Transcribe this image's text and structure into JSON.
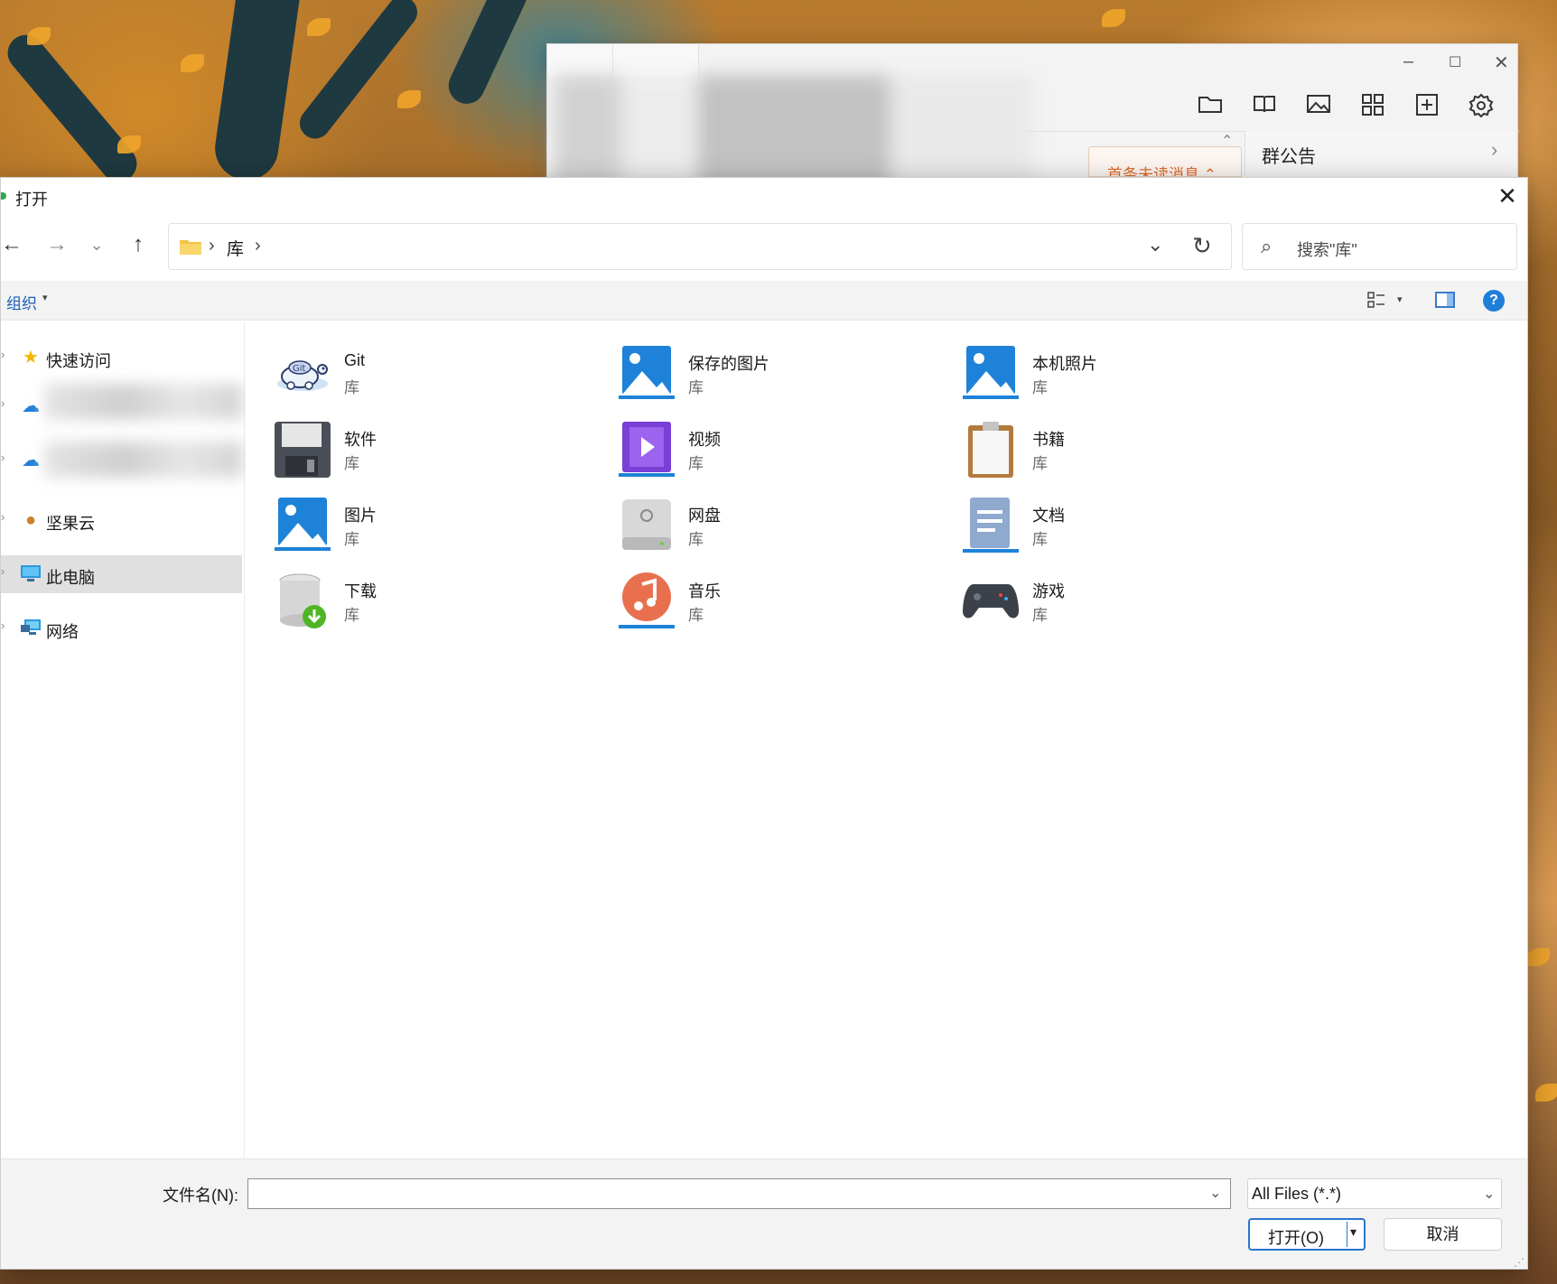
{
  "background_window": {
    "window_controls": [
      "–",
      "☐",
      "✕"
    ],
    "toolbar_icons": [
      "folder-icon",
      "book-icon",
      "image-icon",
      "apps-grid-icon",
      "add-screenshot-icon",
      "settings-icon"
    ],
    "notice_label": "群公告",
    "unread_label": "首条未读消息 ⌃"
  },
  "dialog": {
    "title": "打开",
    "close_glyph": "✕",
    "nav": {
      "back": "←",
      "forward": "→",
      "recent": "⌄",
      "up": "↑"
    },
    "address": {
      "path": [
        "库"
      ],
      "separator": "›",
      "dropdown": "⌄",
      "refresh": "↻"
    },
    "search": {
      "placeholder": "搜索\"库\"",
      "icon": "⌕"
    },
    "toolbar": {
      "organize_label": "组织",
      "organize_arrow": "▾",
      "view_arrow": "▾",
      "help": "?"
    },
    "sidebar": {
      "items": [
        {
          "label": "快速访问",
          "icon": "star-icon",
          "glyph": "★"
        },
        {
          "label": "",
          "icon": "onedrive-icon",
          "glyph": "☁"
        },
        {
          "label": "",
          "icon": "onedrive-icon",
          "glyph": "☁"
        },
        {
          "label": "坚果云",
          "icon": "nutstore-icon",
          "glyph": "●"
        },
        {
          "label": "此电脑",
          "icon": "computer-icon",
          "glyph": "▭"
        },
        {
          "label": "网络",
          "icon": "network-icon",
          "glyph": "▣"
        }
      ],
      "chevron": "›"
    },
    "libraries": [
      {
        "name": "Git",
        "type": "库",
        "icon": "git-turtle-icon"
      },
      {
        "name": "保存的图片",
        "type": "库",
        "icon": "picture-icon"
      },
      {
        "name": "本机照片",
        "type": "库",
        "icon": "picture-icon"
      },
      {
        "name": "软件",
        "type": "库",
        "icon": "floppy-disk-icon"
      },
      {
        "name": "视频",
        "type": "库",
        "icon": "video-icon"
      },
      {
        "name": "书籍",
        "type": "库",
        "icon": "clipboard-icon"
      },
      {
        "name": "图片",
        "type": "库",
        "icon": "picture-icon"
      },
      {
        "name": "网盘",
        "type": "库",
        "icon": "drive-icon"
      },
      {
        "name": "文档",
        "type": "库",
        "icon": "document-icon"
      },
      {
        "name": "下载",
        "type": "库",
        "icon": "download-database-icon"
      },
      {
        "name": "音乐",
        "type": "库",
        "icon": "music-icon"
      },
      {
        "name": "游戏",
        "type": "库",
        "icon": "gamepad-icon"
      }
    ],
    "footer": {
      "filename_label": "文件名(N):",
      "filename_value": "",
      "filename_dropdown": "⌄",
      "filter_value": "All Files (*.*)",
      "filter_dropdown": "⌄",
      "open_label": "打开(O)",
      "open_arrow": "▾",
      "cancel_label": "取消"
    }
  }
}
